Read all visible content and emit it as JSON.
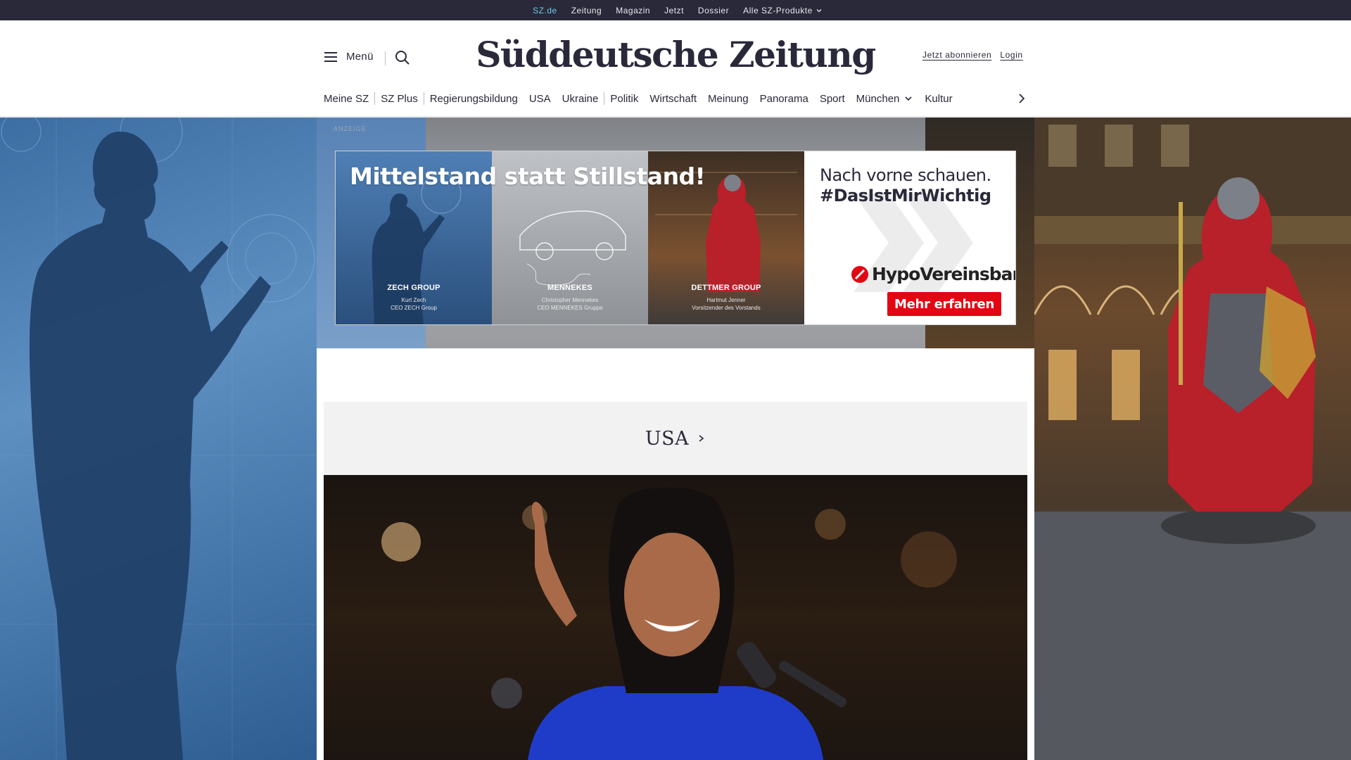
{
  "topbar": {
    "items": [
      {
        "label": "SZ.de",
        "active": true
      },
      {
        "label": "Zeitung",
        "active": false
      },
      {
        "label": "Magazin",
        "active": false
      },
      {
        "label": "Jetzt",
        "active": false
      },
      {
        "label": "Dossier",
        "active": false
      },
      {
        "label": "Alle SZ-Produkte",
        "active": false,
        "dropdown": true
      }
    ]
  },
  "header": {
    "menu_label": "Menü",
    "logo_text": "Süddeutsche Zeitung",
    "subscribe_label": "Jetzt abonnieren",
    "login_label": "Login"
  },
  "nav": {
    "items": [
      "Meine SZ",
      "SZ Plus",
      "Regierungsbildung",
      "USA",
      "Ukraine",
      "Politik",
      "Wirtschaft",
      "Meinung",
      "Panorama",
      "Sport",
      "München",
      "Kultur"
    ]
  },
  "ad": {
    "label": "ANZEIGE",
    "headline": "Mittelstand statt Stillstand!",
    "panels": [
      {
        "brand": "ZECH GROUP",
        "person_line1": "Kurt Zech",
        "person_line2": "CEO ZECH Group"
      },
      {
        "brand": "MENNEKES",
        "person_line1": "Christopher Mennekes",
        "person_line2": "CEO MENNEKES Gruppe"
      },
      {
        "brand": "DETTMER GROUP",
        "person_line1": "Hartmut Jenner",
        "person_line2": "Vorsitzender des Vorstands"
      }
    ],
    "tagline1": "Nach vorne schauen.",
    "tagline2": "#DasIstMirWichtig",
    "advertiser": "HypoVereinsbank",
    "cta": "Mehr erfahren"
  },
  "section": {
    "title": "USA"
  },
  "colors": {
    "topbar_bg": "#29293a",
    "active_link": "#71c5e8",
    "cta_red": "#e30613",
    "section_bg": "#f2f2f2"
  },
  "icons": [
    "hamburger-icon",
    "search-icon",
    "chevron-down-icon",
    "chevron-right-icon"
  ]
}
